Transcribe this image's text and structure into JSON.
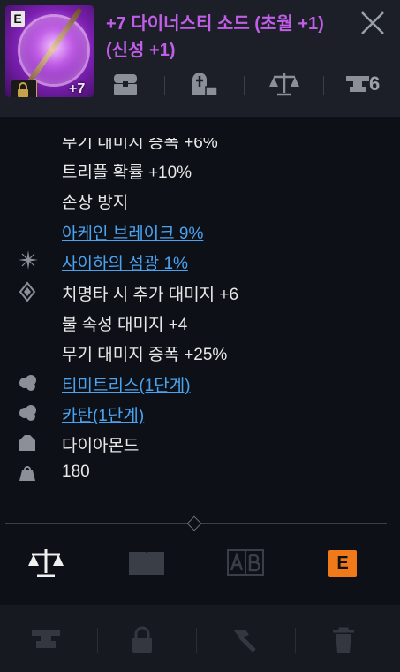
{
  "item": {
    "grade_badge": "E",
    "enhance_badge": "+7",
    "title": "+7 다이너스티 소드 (초월 +1) (신성 +1)"
  },
  "header_icons": {
    "icons": [
      "chest-icon",
      "tombstone-box-icon",
      "balance-scale-icon",
      "anvil-icon"
    ],
    "anvil_count": "6"
  },
  "stats": {
    "partial_top": "무기 대미지 증폭 +6%",
    "triple_chance": "트리플 확률 +10%",
    "damage_prevention": "손상 방지",
    "arcane_break": "아케인 브레이크 9%",
    "saiha_flash": "사이하의 섬광 1%",
    "crit_extra_damage": "치명타 시 추가 대미지 +6",
    "fire_damage": "불 속성 대미지 +4",
    "weapon_amplify": "무기 대미지 증폭 +25%",
    "timitris": "티미트리스(1단계)",
    "kartan": "카탄(1단계)",
    "material": "다이아몬드",
    "weight": "180"
  },
  "tabs": {
    "e_label": "E"
  },
  "colors": {
    "title": "#c05ee8",
    "link": "#4ba3f0",
    "accent_orange": "#f07a1a",
    "background": "#0d1117",
    "header_bg": "#1c1f27"
  }
}
